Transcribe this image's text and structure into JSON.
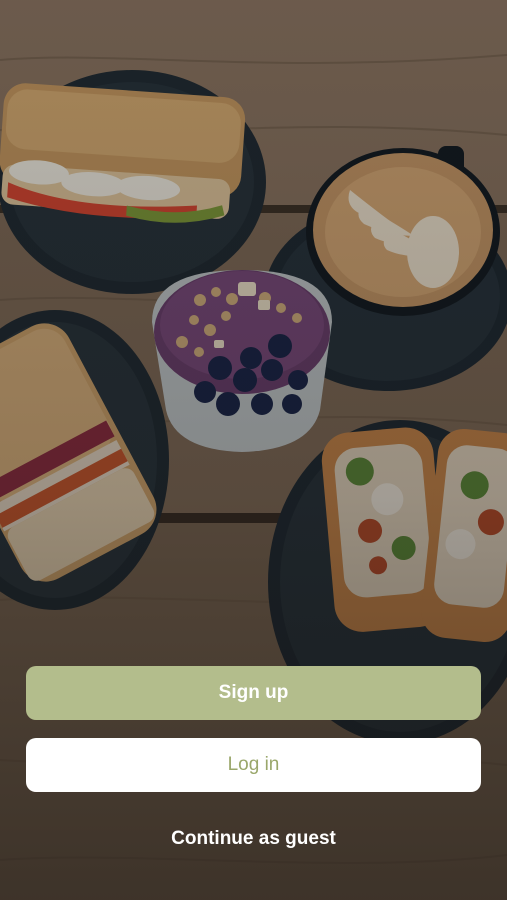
{
  "background": {
    "image_name": "cafe-food-table-photo"
  },
  "actions": {
    "signup_label": "Sign up",
    "login_label": "Log in",
    "guest_label": "Continue as guest"
  },
  "colors": {
    "accent": "#b3bd8c",
    "accent_text": "#9aa76b",
    "button_light": "#ffffff"
  }
}
